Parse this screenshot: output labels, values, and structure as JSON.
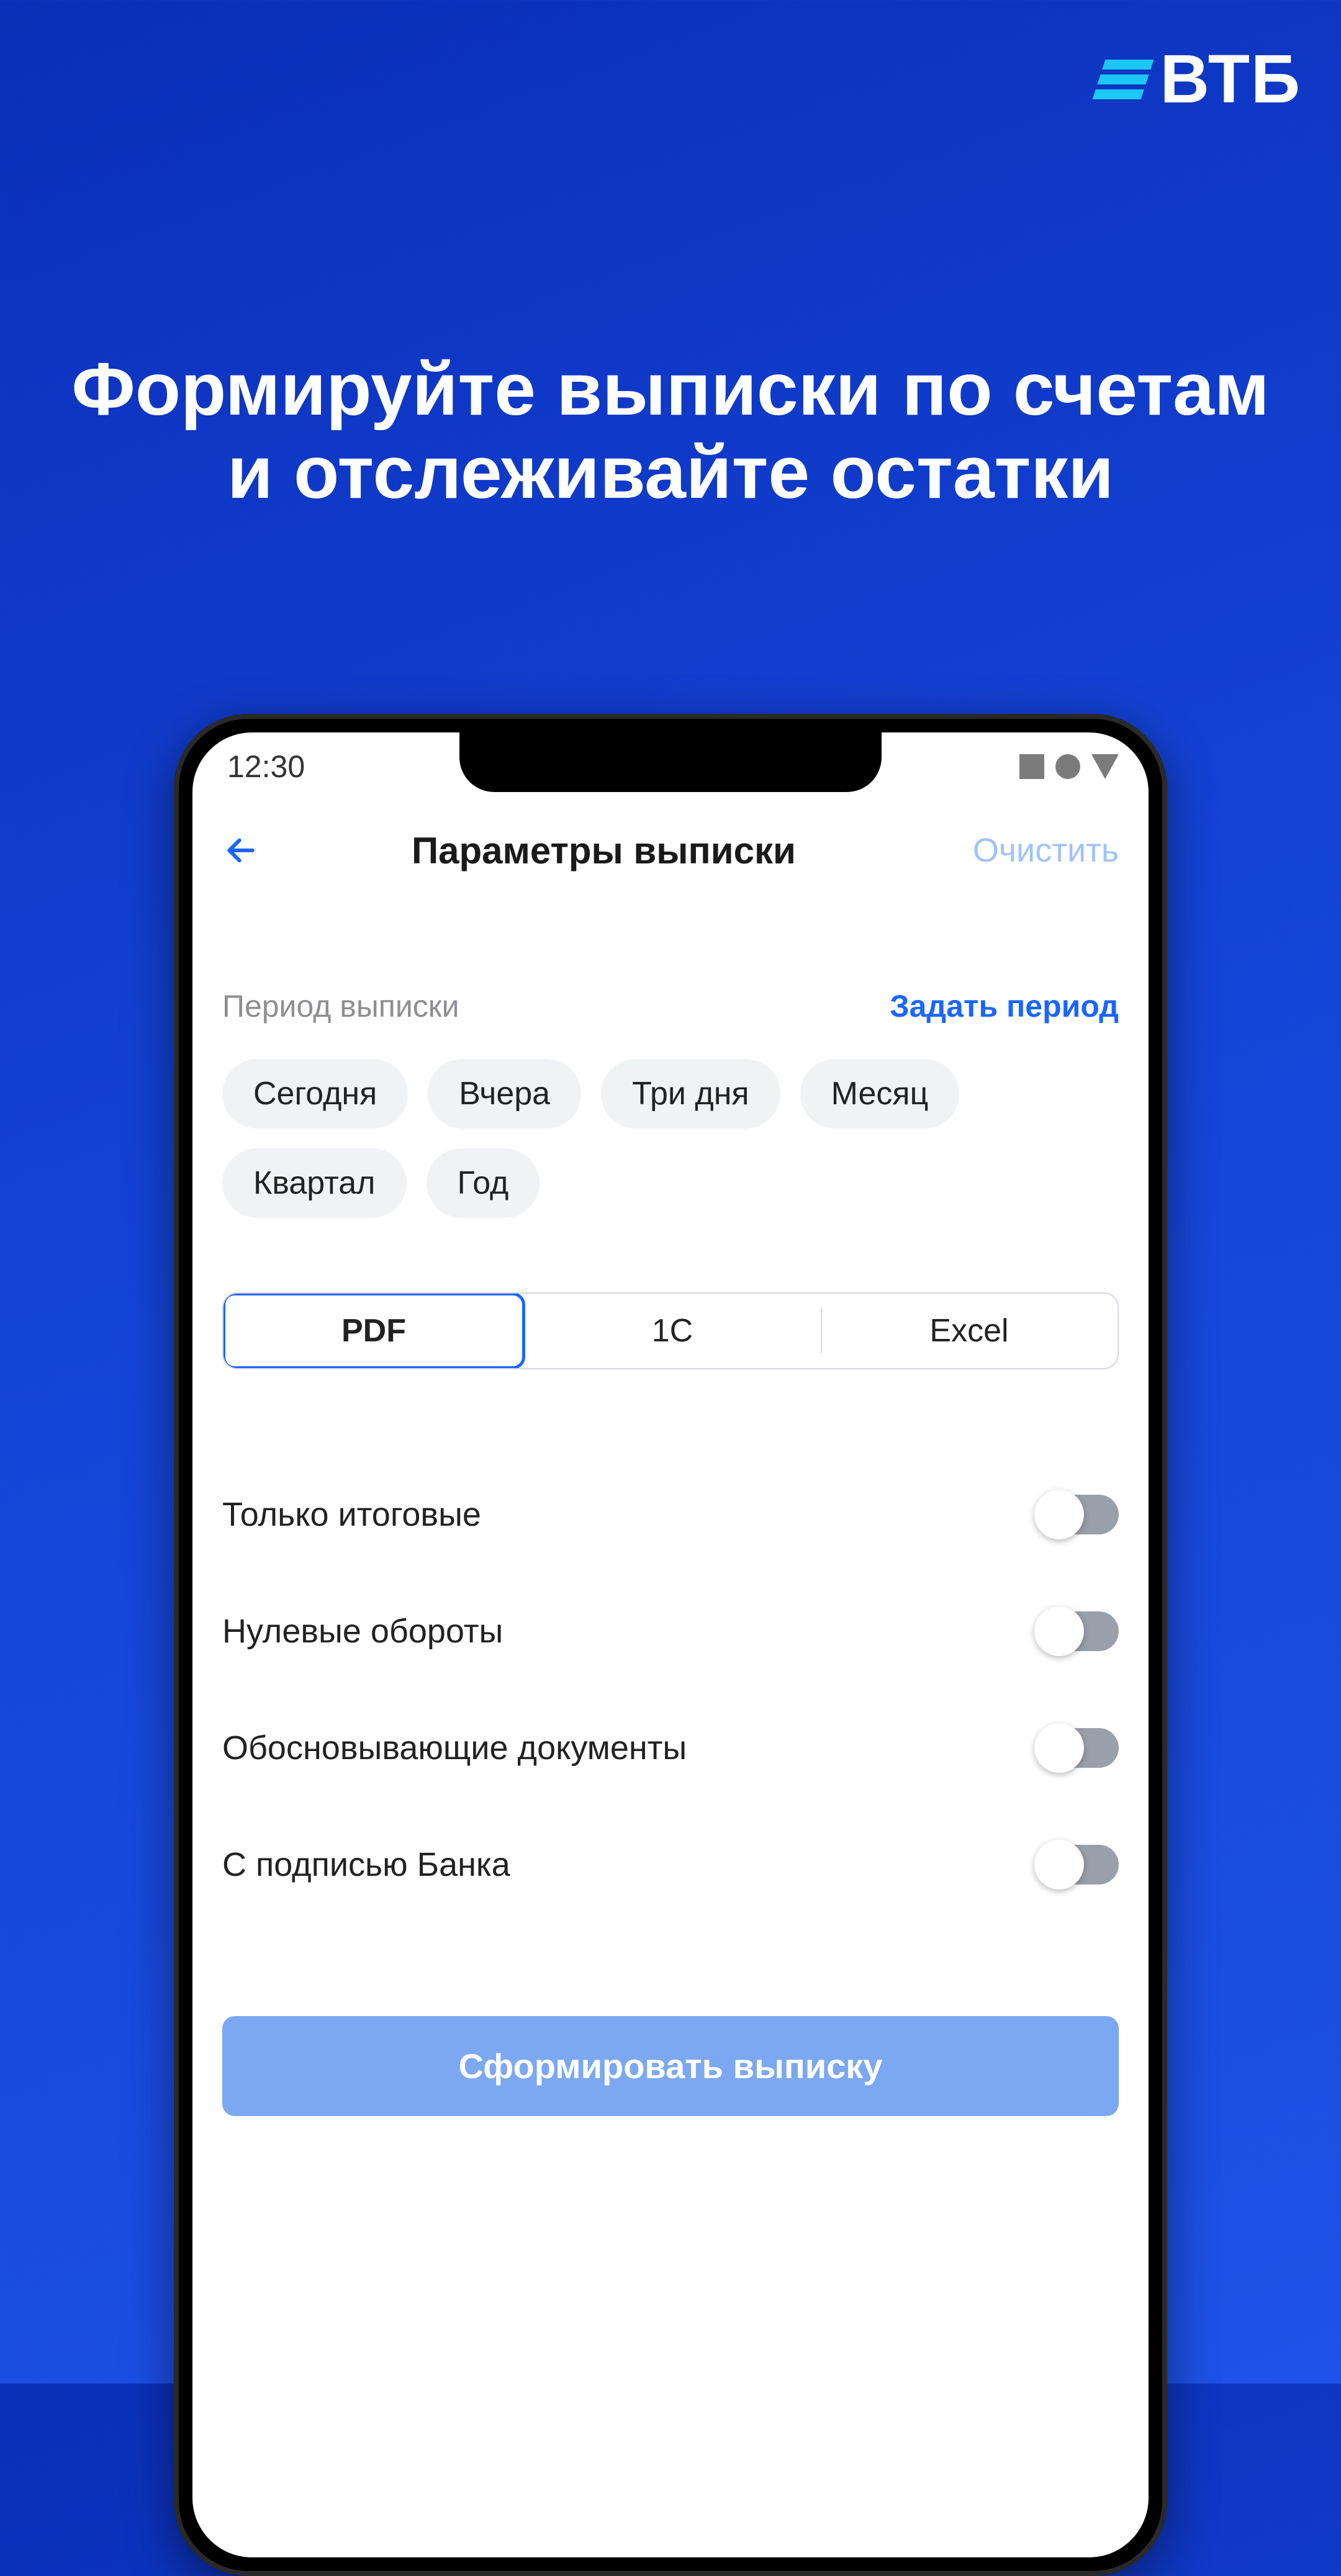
{
  "brand": {
    "name": "ВТБ"
  },
  "headline": "Формируйте выписки по счетам и отслеживайте остатки",
  "statusbar": {
    "time": "12:30"
  },
  "header": {
    "title": "Параметры выписки",
    "clear": "Очистить"
  },
  "period": {
    "label": "Период выписки",
    "set_link": "Задать период",
    "chips": [
      "Сегодня",
      "Вчера",
      "Три дня",
      "Месяц",
      "Квартал",
      "Год"
    ]
  },
  "formats": {
    "options": [
      "PDF",
      "1C",
      "Excel"
    ],
    "active_index": 0
  },
  "toggles": [
    {
      "label": "Только итоговые",
      "on": false
    },
    {
      "label": "Нулевые обороты",
      "on": false
    },
    {
      "label": "Обосновывающие документы",
      "on": false
    },
    {
      "label": "С подписью Банка",
      "on": false
    }
  ],
  "cta": "Сформировать выписку"
}
